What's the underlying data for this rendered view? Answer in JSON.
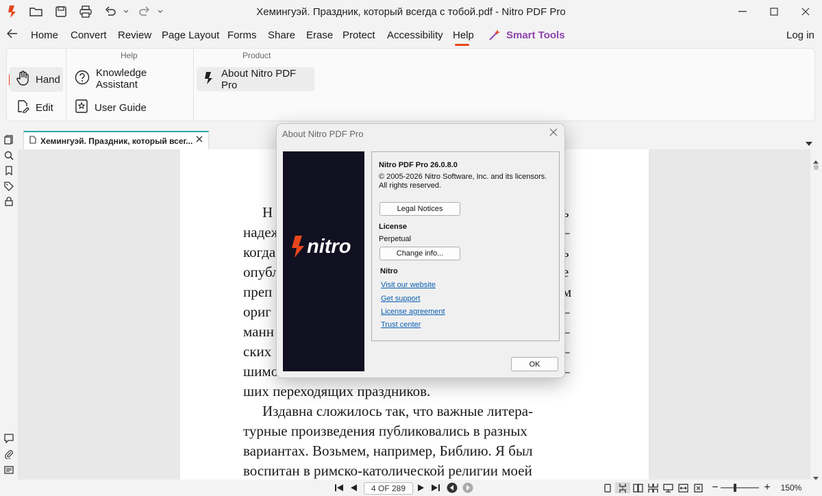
{
  "window": {
    "title": "Хемингуэй. Праздник, который всегда с тобой.pdf - Nitro PDF Pro"
  },
  "menu": {
    "items": [
      "Home",
      "Convert",
      "Review",
      "Page Layout",
      "Forms",
      "Share",
      "Erase",
      "Protect",
      "Accessibility",
      "Help"
    ],
    "smart_tools": "Smart Tools",
    "login": "Log in",
    "active": "Help"
  },
  "ribbon": {
    "mode_buttons": [
      "Hand",
      "Edit"
    ],
    "help_group": {
      "label": "Help",
      "buttons": [
        "Knowledge Assistant",
        "User Guide"
      ]
    },
    "product_group": {
      "label": "Product",
      "buttons": [
        "About Nitro PDF Pro"
      ]
    }
  },
  "tab": {
    "label": "Хемингуэй. Праздник, который всег..."
  },
  "document": {
    "lines": [
      "Н",
      "надеж",
      "когда",
      "опубл",
      "преп",
      "ориг",
      "манн",
      "ских",
      "шимо",
      "ших переходящих праздников.",
      "Издавна сложилось так, что важные литера-",
      "турные произведения публиковались в разных",
      "вариантах. Возьмем, например, Библию. Я был",
      "воспитан в римско-католической религии моей"
    ],
    "right_chars": [
      "ь",
      "–",
      "ь",
      "е",
      "м",
      "–",
      "–",
      "–",
      "–"
    ]
  },
  "dialog": {
    "title": "About Nitro PDF Pro",
    "logo_text": "nitro",
    "product_version": "Nitro PDF Pro 26.0.8.0",
    "copyright": "© 2005-2026 Nitro Software, Inc. and its licensors.",
    "rights": "All rights reserved.",
    "legal_button": "Legal Notices",
    "license_heading": "License",
    "license_value": "Perpetual",
    "change_button": "Change info...",
    "nitro_heading": "Nitro",
    "links": [
      "Visit our website",
      "Get support",
      "License agreement",
      "Trust center"
    ],
    "ok_button": "OK"
  },
  "status": {
    "page_indicator": "4 OF 289",
    "zoom": "150%"
  },
  "colors": {
    "accent": "#e8461b",
    "tab_accent": "#28a7a5",
    "smart_tools": "#8e44ad",
    "logo_bg": "#111021",
    "link": "#0b5fb3"
  }
}
